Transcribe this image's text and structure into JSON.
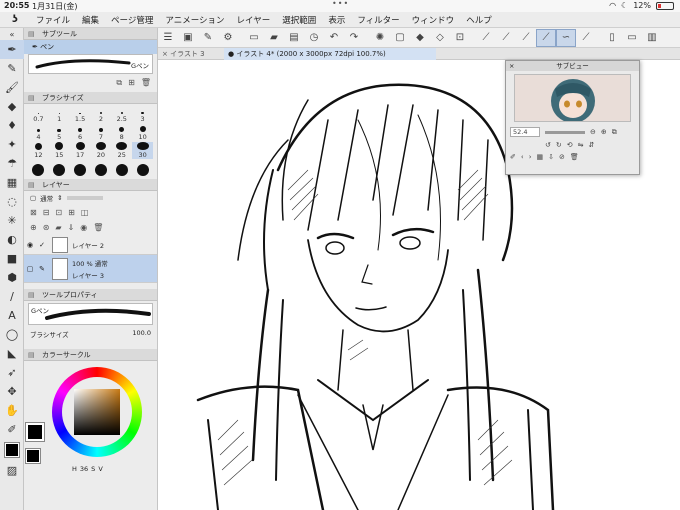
{
  "status": {
    "time": "20:55",
    "date": "1月31日(金)",
    "battery": "12%"
  },
  "menu": {
    "items": [
      "ファイル",
      "編集",
      "ページ管理",
      "アニメーション",
      "レイヤー",
      "選択範囲",
      "表示",
      "フィルター",
      "ウィンドウ",
      "ヘルプ"
    ]
  },
  "tabs": {
    "tab1": "イラスト 3",
    "tab2": "イラスト 4* (2000 x 3000px 72dpi 100.7%)"
  },
  "subtool": {
    "header": "サブツール",
    "selected_item": "ペン",
    "preview_label": "Gペン"
  },
  "brush_size": {
    "header": "ブラシサイズ",
    "sizes": [
      "0.7",
      "1",
      "1.5",
      "2",
      "2.5",
      "3",
      "4",
      "5",
      "6",
      "7",
      "8",
      "10",
      "12",
      "15",
      "17",
      "20",
      "25",
      "30",
      "",
      "",
      "",
      "",
      "",
      ""
    ]
  },
  "layer": {
    "header": "レイヤー",
    "blend_mode": "通常",
    "rows": [
      {
        "name": "レイヤー 2",
        "info": ""
      },
      {
        "name": "レイヤー 3",
        "info": "100 % 通常"
      }
    ]
  },
  "tool_property": {
    "header": "ツールプロパティ",
    "brush_name": "Gペン",
    "brush_size_label": "ブラシサイズ",
    "brush_size_value": "100.0"
  },
  "color": {
    "header": "カラーサークル",
    "h_value": "36",
    "s_label": "S",
    "v_label": "V"
  },
  "subview": {
    "title": "サブビュー",
    "zoom": "52.4"
  },
  "colors": {
    "accent": "#b9cfea",
    "panel_bg": "#ececec"
  }
}
